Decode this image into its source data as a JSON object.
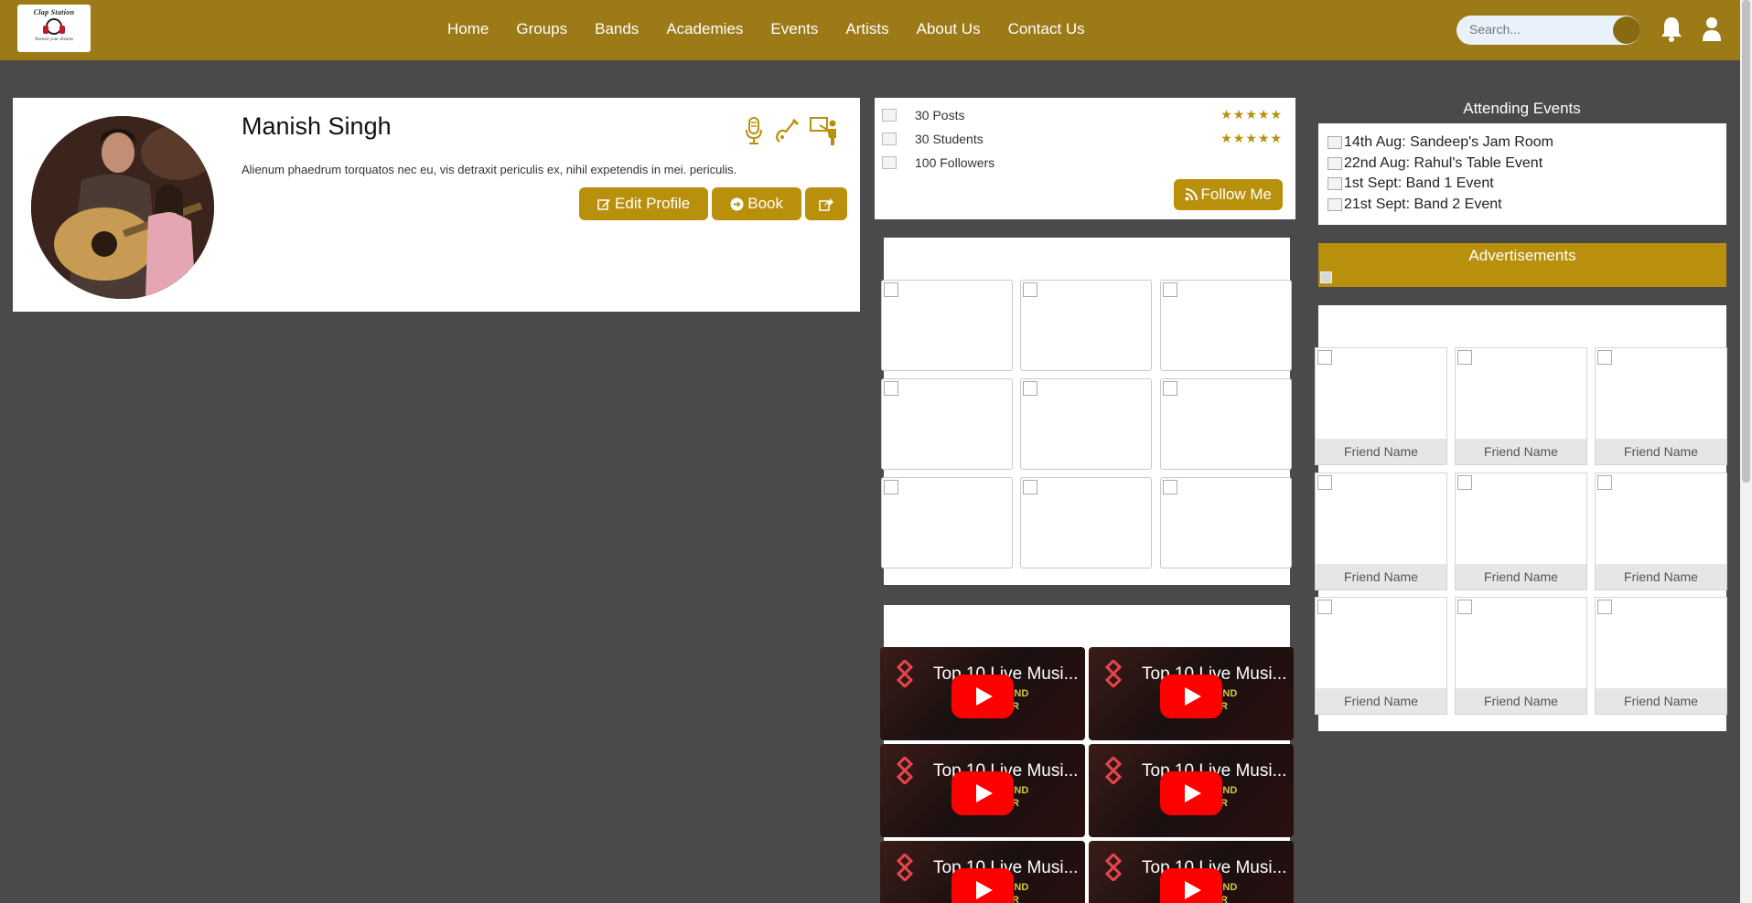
{
  "brand": {
    "logo_title": "Clap Station",
    "logo_tagline": "Nurture your dreams"
  },
  "nav": {
    "links": [
      "Home",
      "Groups",
      "Bands",
      "Academies",
      "Events",
      "Artists",
      "About Us",
      "Contact Us"
    ],
    "search_placeholder": "Search..."
  },
  "profile": {
    "name": "Manish Singh",
    "description": "Alienum phaedrum torquatos nec eu, vis detraxit periculis ex, nihil expetendis in mei. periculis.",
    "edit_label": "Edit Profile",
    "book_label": "Book",
    "role_icons": [
      "microphone-icon",
      "guitar-icon",
      "teacher-icon"
    ]
  },
  "stats": {
    "posts": "30 Posts",
    "students": "30 Students",
    "followers": "100 Followers",
    "stars": "★★★★★",
    "follow_label": "Follow Me"
  },
  "videos": [
    {
      "title": "Top 10 Live Musi...",
      "caption_line1": "MUSIC BAND",
      "caption_line2": "DELHI/NCR"
    },
    {
      "title": "Top 10 Live Musi...",
      "caption_line1": "MUSIC BAND",
      "caption_line2": "DELHI/NCR"
    },
    {
      "title": "Top 10 Live Musi...",
      "caption_line1": "MUSIC BAND",
      "caption_line2": "DELHI/NCR"
    },
    {
      "title": "Top 10 Live Musi...",
      "caption_line1": "MUSIC BAND",
      "caption_line2": "DELHI/NCR"
    },
    {
      "title": "Top 10 Live Musi...",
      "caption_line1": "MUSIC BAND",
      "caption_line2": "DELHI/NCR"
    },
    {
      "title": "Top 10 Live Musi...",
      "caption_line1": "MUSIC BAND",
      "caption_line2": "DELHI/NCR"
    }
  ],
  "events": {
    "heading": "Attending Events",
    "items": [
      "14th Aug: Sandeep's Jam Room",
      "22nd Aug: Rahul's Table Event",
      "1st Sept: Band 1 Event",
      "21st Sept: Band 2 Event"
    ]
  },
  "ads": {
    "heading": "Advertisements"
  },
  "friends": {
    "names": [
      "Friend Name",
      "Friend Name",
      "Friend Name",
      "Friend Name",
      "Friend Name",
      "Friend Name",
      "Friend Name",
      "Friend Name",
      "Friend Name"
    ]
  },
  "colors": {
    "nav_bg": "#9b7a17",
    "accent": "#b8900b",
    "page_bg": "#4a4a4a"
  }
}
